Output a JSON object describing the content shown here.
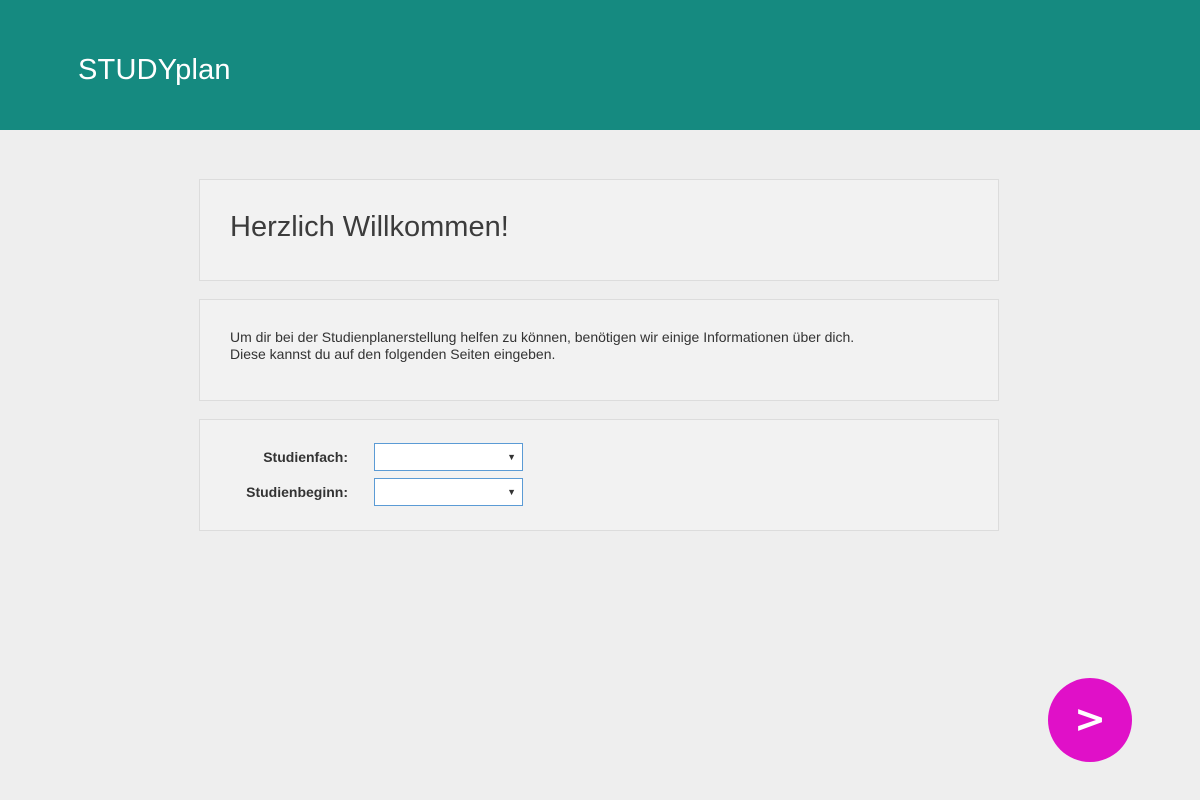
{
  "app": {
    "title": "STUDYplan"
  },
  "welcome": {
    "heading": "Herzlich Willkommen!"
  },
  "info": {
    "line1": "Um dir bei der Studienplanerstellung helfen zu können, benötigen wir einige Informationen über dich.",
    "line2": "Diese kannst du auf den folgenden Seiten eingeben."
  },
  "form": {
    "studienfach": {
      "label": "Studienfach:",
      "value": ""
    },
    "studienbeginn": {
      "label": "Studienbeginn:",
      "value": ""
    },
    "dropdown_icon": "triangle-down-icon"
  },
  "navigation": {
    "next_label": ">",
    "next_icon": "chevron-right-icon"
  },
  "colors": {
    "header": "#158a80",
    "background": "#eeeeee",
    "panel": "#f2f2f2",
    "next_button": "#e010c8",
    "select_border": "#5b9bd5"
  }
}
